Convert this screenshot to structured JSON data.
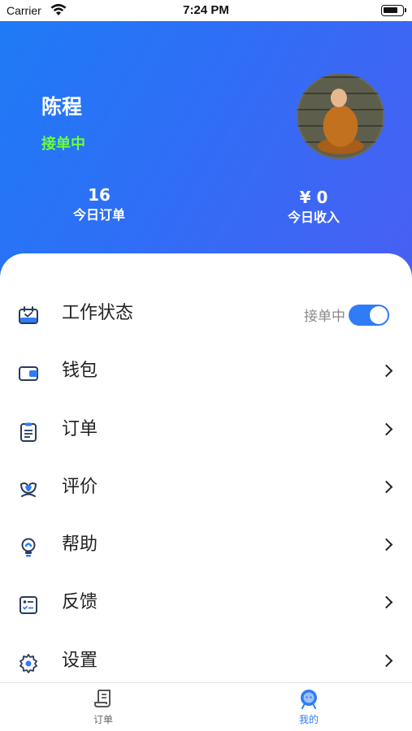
{
  "status_bar": {
    "carrier": "Carrier",
    "time": "7:24 PM"
  },
  "profile": {
    "name": "陈程",
    "status": "接单中",
    "avatar": "avatar-photo"
  },
  "stats": {
    "orders_value": "16",
    "orders_label": "今日订单",
    "income_value": "¥ 0",
    "income_label": "今日收入"
  },
  "menu": {
    "work_status": {
      "label": "工作状态",
      "toggle_text": "接单中",
      "toggle_on": true,
      "icon": "calendar-check-icon"
    },
    "wallet": {
      "label": "钱包",
      "icon": "wallet-icon"
    },
    "orders": {
      "label": "订单",
      "icon": "clipboard-icon"
    },
    "reviews": {
      "label": "评价",
      "icon": "lotus-icon"
    },
    "help": {
      "label": "帮助",
      "icon": "lightbulb-icon"
    },
    "feedback": {
      "label": "反馈",
      "icon": "checklist-icon"
    },
    "settings": {
      "label": "设置",
      "icon": "gear-icon"
    }
  },
  "tabbar": {
    "orders_label": "订单",
    "me_label": "我的",
    "active_tab": "我的"
  },
  "colors": {
    "accent": "#2f7cf6",
    "header_gradient_start": "#1e7bf5",
    "header_gradient_end": "#4a5ff2",
    "status_green": "#6cff3a"
  }
}
